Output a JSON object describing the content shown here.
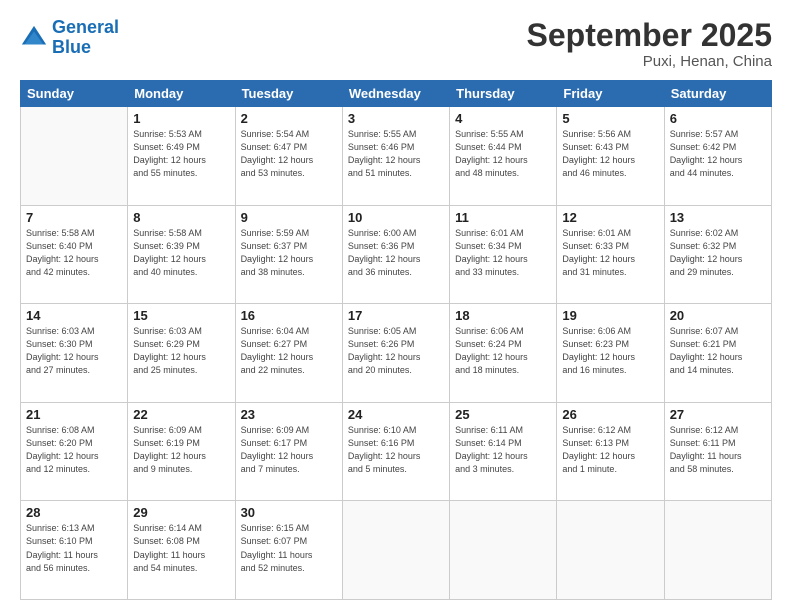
{
  "header": {
    "logo_line1": "General",
    "logo_line2": "Blue",
    "month": "September 2025",
    "location": "Puxi, Henan, China"
  },
  "days_of_week": [
    "Sunday",
    "Monday",
    "Tuesday",
    "Wednesday",
    "Thursday",
    "Friday",
    "Saturday"
  ],
  "weeks": [
    [
      {
        "day": "",
        "info": ""
      },
      {
        "day": "1",
        "info": "Sunrise: 5:53 AM\nSunset: 6:49 PM\nDaylight: 12 hours\nand 55 minutes."
      },
      {
        "day": "2",
        "info": "Sunrise: 5:54 AM\nSunset: 6:47 PM\nDaylight: 12 hours\nand 53 minutes."
      },
      {
        "day": "3",
        "info": "Sunrise: 5:55 AM\nSunset: 6:46 PM\nDaylight: 12 hours\nand 51 minutes."
      },
      {
        "day": "4",
        "info": "Sunrise: 5:55 AM\nSunset: 6:44 PM\nDaylight: 12 hours\nand 48 minutes."
      },
      {
        "day": "5",
        "info": "Sunrise: 5:56 AM\nSunset: 6:43 PM\nDaylight: 12 hours\nand 46 minutes."
      },
      {
        "day": "6",
        "info": "Sunrise: 5:57 AM\nSunset: 6:42 PM\nDaylight: 12 hours\nand 44 minutes."
      }
    ],
    [
      {
        "day": "7",
        "info": "Sunrise: 5:58 AM\nSunset: 6:40 PM\nDaylight: 12 hours\nand 42 minutes."
      },
      {
        "day": "8",
        "info": "Sunrise: 5:58 AM\nSunset: 6:39 PM\nDaylight: 12 hours\nand 40 minutes."
      },
      {
        "day": "9",
        "info": "Sunrise: 5:59 AM\nSunset: 6:37 PM\nDaylight: 12 hours\nand 38 minutes."
      },
      {
        "day": "10",
        "info": "Sunrise: 6:00 AM\nSunset: 6:36 PM\nDaylight: 12 hours\nand 36 minutes."
      },
      {
        "day": "11",
        "info": "Sunrise: 6:01 AM\nSunset: 6:34 PM\nDaylight: 12 hours\nand 33 minutes."
      },
      {
        "day": "12",
        "info": "Sunrise: 6:01 AM\nSunset: 6:33 PM\nDaylight: 12 hours\nand 31 minutes."
      },
      {
        "day": "13",
        "info": "Sunrise: 6:02 AM\nSunset: 6:32 PM\nDaylight: 12 hours\nand 29 minutes."
      }
    ],
    [
      {
        "day": "14",
        "info": "Sunrise: 6:03 AM\nSunset: 6:30 PM\nDaylight: 12 hours\nand 27 minutes."
      },
      {
        "day": "15",
        "info": "Sunrise: 6:03 AM\nSunset: 6:29 PM\nDaylight: 12 hours\nand 25 minutes."
      },
      {
        "day": "16",
        "info": "Sunrise: 6:04 AM\nSunset: 6:27 PM\nDaylight: 12 hours\nand 22 minutes."
      },
      {
        "day": "17",
        "info": "Sunrise: 6:05 AM\nSunset: 6:26 PM\nDaylight: 12 hours\nand 20 minutes."
      },
      {
        "day": "18",
        "info": "Sunrise: 6:06 AM\nSunset: 6:24 PM\nDaylight: 12 hours\nand 18 minutes."
      },
      {
        "day": "19",
        "info": "Sunrise: 6:06 AM\nSunset: 6:23 PM\nDaylight: 12 hours\nand 16 minutes."
      },
      {
        "day": "20",
        "info": "Sunrise: 6:07 AM\nSunset: 6:21 PM\nDaylight: 12 hours\nand 14 minutes."
      }
    ],
    [
      {
        "day": "21",
        "info": "Sunrise: 6:08 AM\nSunset: 6:20 PM\nDaylight: 12 hours\nand 12 minutes."
      },
      {
        "day": "22",
        "info": "Sunrise: 6:09 AM\nSunset: 6:19 PM\nDaylight: 12 hours\nand 9 minutes."
      },
      {
        "day": "23",
        "info": "Sunrise: 6:09 AM\nSunset: 6:17 PM\nDaylight: 12 hours\nand 7 minutes."
      },
      {
        "day": "24",
        "info": "Sunrise: 6:10 AM\nSunset: 6:16 PM\nDaylight: 12 hours\nand 5 minutes."
      },
      {
        "day": "25",
        "info": "Sunrise: 6:11 AM\nSunset: 6:14 PM\nDaylight: 12 hours\nand 3 minutes."
      },
      {
        "day": "26",
        "info": "Sunrise: 6:12 AM\nSunset: 6:13 PM\nDaylight: 12 hours\nand 1 minute."
      },
      {
        "day": "27",
        "info": "Sunrise: 6:12 AM\nSunset: 6:11 PM\nDaylight: 11 hours\nand 58 minutes."
      }
    ],
    [
      {
        "day": "28",
        "info": "Sunrise: 6:13 AM\nSunset: 6:10 PM\nDaylight: 11 hours\nand 56 minutes."
      },
      {
        "day": "29",
        "info": "Sunrise: 6:14 AM\nSunset: 6:08 PM\nDaylight: 11 hours\nand 54 minutes."
      },
      {
        "day": "30",
        "info": "Sunrise: 6:15 AM\nSunset: 6:07 PM\nDaylight: 11 hours\nand 52 minutes."
      },
      {
        "day": "",
        "info": ""
      },
      {
        "day": "",
        "info": ""
      },
      {
        "day": "",
        "info": ""
      },
      {
        "day": "",
        "info": ""
      }
    ]
  ]
}
